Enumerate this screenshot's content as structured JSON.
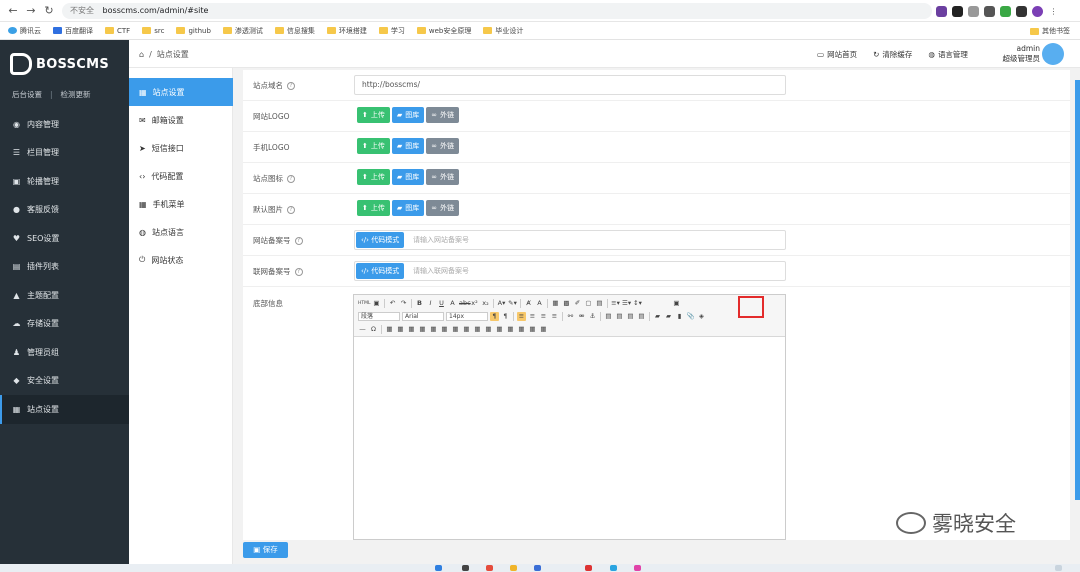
{
  "browser": {
    "insecure_label": "不安全",
    "url": "bosscms.com/admin/#site",
    "bookmarks": [
      "腾讯云",
      "百度翻译",
      "CTF",
      "src",
      "github",
      "渗透测试",
      "信息搜集",
      "环境搭建",
      "学习",
      "web安全原理",
      "毕业设计"
    ],
    "other_bookmarks": "其他书签"
  },
  "sidebar": {
    "logo": "BOSSCMS",
    "links": [
      "后台设置",
      "检测更新"
    ],
    "items": [
      {
        "label": "内容管理",
        "icon": "eye-icon"
      },
      {
        "label": "栏目管理",
        "icon": "list-icon"
      },
      {
        "label": "轮播管理",
        "icon": "image-icon"
      },
      {
        "label": "客服反馈",
        "icon": "chat-icon"
      },
      {
        "label": "SEO设置",
        "icon": "heart-icon"
      },
      {
        "label": "插件列表",
        "icon": "file-icon"
      },
      {
        "label": "主题配置",
        "icon": "car-icon"
      },
      {
        "label": "存储设置",
        "icon": "cloud-icon"
      },
      {
        "label": "管理员组",
        "icon": "users-icon"
      },
      {
        "label": "安全设置",
        "icon": "shield-icon"
      },
      {
        "label": "站点设置",
        "icon": "doc-icon"
      }
    ]
  },
  "subnav": {
    "items": [
      {
        "label": "站点设置",
        "icon": "doc-icon"
      },
      {
        "label": "邮箱设置",
        "icon": "mail-icon"
      },
      {
        "label": "短信接口",
        "icon": "send-icon"
      },
      {
        "label": "代码配置",
        "icon": "code-icon"
      },
      {
        "label": "手机菜单",
        "icon": "calendar-icon"
      },
      {
        "label": "站点语言",
        "icon": "globe-icon"
      },
      {
        "label": "网站状态",
        "icon": "power-icon"
      }
    ]
  },
  "topbar": {
    "breadcrumb_sep": "/",
    "breadcrumb": "站点设置",
    "actions": [
      "网站首页",
      "清除缓存",
      "语言管理"
    ],
    "admin_name": "admin",
    "admin_role": "超级管理员"
  },
  "form": {
    "site_domain_label": "站点域名",
    "site_domain_value": "http://bosscms/",
    "site_logo_label": "网站LOGO",
    "mobile_logo_label": "手机LOGO",
    "site_icon_label": "站点图标",
    "default_image_label": "默认图片",
    "icp_label": "网站备案号",
    "icp_placeholder": "请输入网站备案号",
    "police_label": "联网备案号",
    "police_placeholder": "请输入联网备案号",
    "upload_btn": "上传",
    "gallery_btn": "图库",
    "external_btn": "外链",
    "code_mode_btn": "代码模式",
    "footer_label": "底部信息",
    "save_btn": "保存"
  },
  "editor": {
    "paragraph_select": "段落",
    "font_select": "Arial",
    "size_select": "14px"
  },
  "watermark": "雾晓安全"
}
